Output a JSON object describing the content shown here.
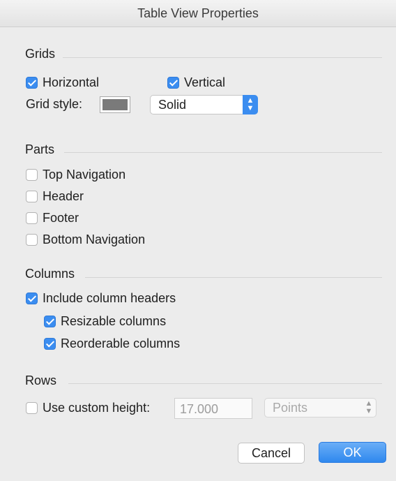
{
  "window": {
    "title": "Table View Properties"
  },
  "grids": {
    "title": "Grids",
    "horizontal": {
      "label": "Horizontal",
      "checked": true
    },
    "vertical": {
      "label": "Vertical",
      "checked": true
    },
    "style_label": "Grid style:",
    "swatch_color": "#7a7a7a",
    "style_value": "Solid"
  },
  "parts": {
    "title": "Parts",
    "items": [
      {
        "label": "Top Navigation",
        "checked": false
      },
      {
        "label": "Header",
        "checked": false
      },
      {
        "label": "Footer",
        "checked": false
      },
      {
        "label": "Bottom Navigation",
        "checked": false
      }
    ]
  },
  "columns": {
    "title": "Columns",
    "include_headers": {
      "label": "Include column headers",
      "checked": true
    },
    "resizable": {
      "label": "Resizable columns",
      "checked": true
    },
    "reorderable": {
      "label": "Reorderable columns",
      "checked": true
    }
  },
  "rows": {
    "title": "Rows",
    "custom_height": {
      "label": "Use custom height:",
      "checked": false
    },
    "height_value": "17.000",
    "unit": "Points"
  },
  "buttons": {
    "cancel": "Cancel",
    "ok": "OK"
  },
  "colors": {
    "accent": "#3b8df0",
    "background": "#ececec"
  }
}
